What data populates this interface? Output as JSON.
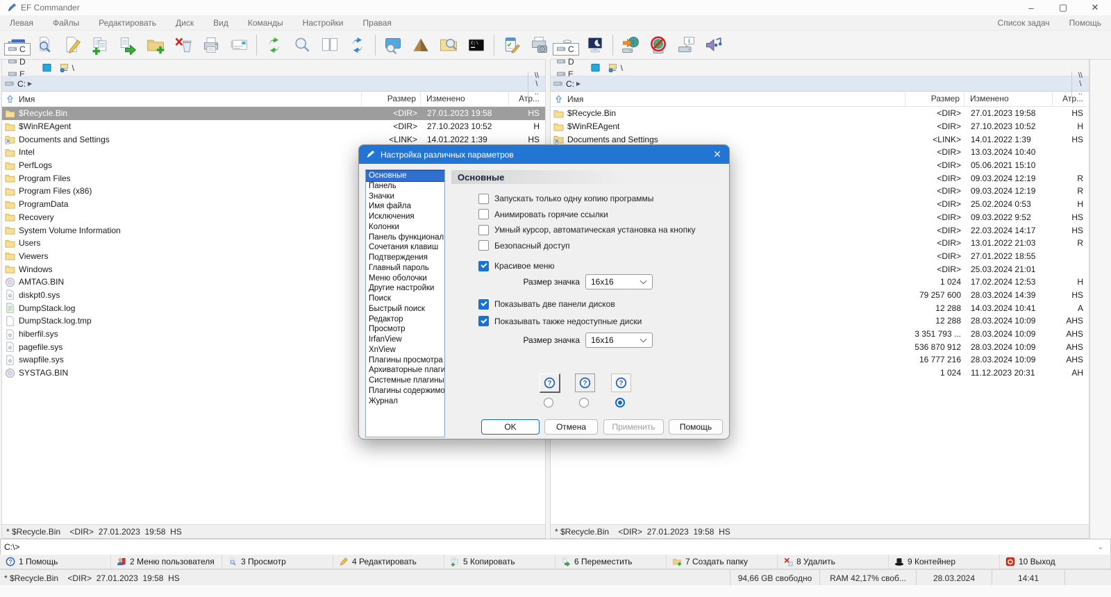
{
  "window": {
    "title": "EF Commander",
    "minimize": "–",
    "maximize": "▢",
    "close": "✕"
  },
  "menu": {
    "items": [
      {
        "label": "Левая"
      },
      {
        "label": "Файлы"
      },
      {
        "label": "Редактировать"
      },
      {
        "label": "Диск"
      },
      {
        "label": "Вид"
      },
      {
        "label": "Команды"
      },
      {
        "label": "Настройки"
      },
      {
        "label": "Правая"
      }
    ],
    "right_items": [
      {
        "label": "Список задач"
      },
      {
        "label": "Помощь"
      }
    ]
  },
  "toolbar": [
    {
      "k": "btn",
      "name": "run-command-button",
      "icon": "#i-run"
    },
    {
      "k": "btn",
      "name": "view-file-button",
      "icon": "#i-viewdoc"
    },
    {
      "k": "btn",
      "name": "edit-file-button",
      "icon": "#i-edit"
    },
    {
      "k": "btn",
      "name": "copy-button",
      "icon": "#i-copy"
    },
    {
      "k": "btn",
      "name": "move-button",
      "icon": "#i-move"
    },
    {
      "k": "btn",
      "name": "new-folder-button",
      "icon": "#i-newfolder"
    },
    {
      "k": "btn",
      "name": "delete-button",
      "icon": "#i-del"
    },
    {
      "k": "btn",
      "name": "print-button",
      "icon": "#i-print"
    },
    {
      "k": "btn",
      "name": "address-card-button",
      "icon": "#i-card"
    },
    {
      "k": "sep",
      "name": "toolbar-separator"
    },
    {
      "k": "btn",
      "name": "refresh-button",
      "icon": "#i-refresh"
    },
    {
      "k": "btn",
      "name": "search-button",
      "icon": "#i-zoom"
    },
    {
      "k": "btn",
      "name": "compare-files-button",
      "icon": "#i-split"
    },
    {
      "k": "btn",
      "name": "sync-dirs-button",
      "icon": "#i-sync"
    },
    {
      "k": "sep",
      "name": "toolbar-separator"
    },
    {
      "k": "btn",
      "name": "fullscreen-view-button",
      "icon": "#i-screenzoom"
    },
    {
      "k": "btn",
      "name": "dir-size-button",
      "icon": "#i-pyramid"
    },
    {
      "k": "btn",
      "name": "folder-search-button",
      "icon": "#i-foldersearch"
    },
    {
      "k": "btn",
      "name": "terminal-button",
      "icon": "#i-terminal"
    },
    {
      "k": "sep",
      "name": "toolbar-separator"
    },
    {
      "k": "btn",
      "name": "options-button",
      "icon": "#i-settings"
    },
    {
      "k": "btn",
      "name": "print-setup-button",
      "icon": "#i-printphoto"
    },
    {
      "k": "btn",
      "name": "recycle-bin-button",
      "icon": "#i-recycle"
    },
    {
      "k": "btn",
      "name": "screensaver-button",
      "icon": "#i-screensaver"
    },
    {
      "k": "sep",
      "name": "toolbar-separator"
    },
    {
      "k": "btn",
      "name": "map-network-drive-button",
      "icon": "#i-netconnect"
    },
    {
      "k": "btn",
      "name": "disconnect-network-drive-button",
      "icon": "#i-netdisconnect"
    },
    {
      "k": "btn",
      "name": "disk-info-button",
      "icon": "#i-diskinfo"
    },
    {
      "k": "btn",
      "name": "sounds-button",
      "icon": "#i-sound"
    }
  ],
  "drivebar": {
    "drives": [
      {
        "label": "C",
        "sel": "true"
      },
      {
        "label": "D"
      },
      {
        "label": "E"
      },
      {
        "label": "F"
      }
    ],
    "root_label": "\\",
    "path": "C:",
    "nav": [
      {
        "label": "\\\\"
      },
      {
        "label": "\\"
      },
      {
        "label": ".."
      }
    ]
  },
  "columns": {
    "name": "Имя",
    "size": "Размер",
    "modified": "Изменено",
    "attr": "Атр..."
  },
  "files": [
    {
      "name": "$Recycle.Bin",
      "icon": "#f-folder",
      "size": "<DIR>",
      "mod": "27.01.2023  19:58",
      "attr": "HS",
      "sel_left": "true"
    },
    {
      "name": "$WinREAgent",
      "icon": "#f-folder",
      "size": "<DIR>",
      "mod": "27.10.2023  10:52",
      "attr": "H"
    },
    {
      "name": "Documents and Settings",
      "icon": "#f-folderlink",
      "size": "<LINK>",
      "mod": "14.01.2022  1:39",
      "attr": "HS"
    },
    {
      "name": "Intel",
      "icon": "#f-folder",
      "size": "<DIR>",
      "mod": "13.03.2024  10:40",
      "attr": ""
    },
    {
      "name": "PerfLogs",
      "icon": "#f-folder",
      "size": "<DIR>",
      "mod": "05.06.2021  15:10",
      "attr": ""
    },
    {
      "name": "Program Files",
      "icon": "#f-folder",
      "size": "<DIR>",
      "mod": "09.03.2024  12:19",
      "attr": "R"
    },
    {
      "name": "Program Files (x86)",
      "icon": "#f-folder",
      "size": "<DIR>",
      "mod": "09.03.2024  12:19",
      "attr": "R"
    },
    {
      "name": "ProgramData",
      "icon": "#f-folder",
      "size": "<DIR>",
      "mod": "25.02.2024  0:53",
      "attr": "H"
    },
    {
      "name": "Recovery",
      "icon": "#f-folder",
      "size": "<DIR>",
      "mod": "09.03.2022  9:52",
      "attr": "HS"
    },
    {
      "name": "System Volume Information",
      "icon": "#f-folder",
      "size": "<DIR>",
      "mod": "22.03.2024  14:17",
      "attr": "HS"
    },
    {
      "name": "Users",
      "icon": "#f-folder",
      "size": "<DIR>",
      "mod": "13.01.2022  21:03",
      "attr": "R"
    },
    {
      "name": "Viewers",
      "icon": "#f-folder",
      "size": "<DIR>",
      "mod": "27.01.2022  18:55",
      "attr": ""
    },
    {
      "name": "Windows",
      "icon": "#f-folder",
      "size": "<DIR>",
      "mod": "25.03.2024  21:01",
      "attr": ""
    },
    {
      "name": "AMTAG.BIN",
      "icon": "#f-cd",
      "size": "1 024",
      "mod": "17.02.2024  12:53",
      "attr": "H"
    },
    {
      "name": "diskpt0.sys",
      "icon": "#f-sys",
      "size": "79 257 600",
      "mod": "28.03.2024  14:39",
      "attr": "HS"
    },
    {
      "name": "DumpStack.log",
      "icon": "#f-log",
      "size": "12 288",
      "mod": "14.03.2024  10:41",
      "attr": "A"
    },
    {
      "name": "DumpStack.log.tmp",
      "icon": "#f-tmp",
      "size": "12 288",
      "mod": "28.03.2024  10:09",
      "attr": "AHS"
    },
    {
      "name": "hiberfil.sys",
      "icon": "#f-sys",
      "size": "3 351 793 ...",
      "mod": "28.03.2024  10:09",
      "attr": "AHS"
    },
    {
      "name": "pagefile.sys",
      "icon": "#f-sys",
      "size": "536 870 912",
      "mod": "28.03.2024  10:09",
      "attr": "AHS"
    },
    {
      "name": "swapfile.sys",
      "icon": "#f-sys",
      "size": "16 777 216",
      "mod": "28.03.2024  10:09",
      "attr": "AHS"
    },
    {
      "name": "SYSTAG.BIN",
      "icon": "#f-cd",
      "size": "1 024",
      "mod": "11.12.2023  20:31",
      "attr": "AH"
    }
  ],
  "panel_status": "* $Recycle.Bin    <DIR>  27.01.2023  19:58  HS",
  "cmdline": {
    "value": "C:\\>",
    "caret": "⌄"
  },
  "function_bar": [
    {
      "label": "1 Помощь",
      "icon": "#f-help",
      "name": "f1-help-button"
    },
    {
      "label": "2 Меню пользователя",
      "icon": "#f-user",
      "name": "f2-user-menu-button"
    },
    {
      "label": "3 Просмотр",
      "icon": "#i-viewdoc",
      "name": "f3-view-button"
    },
    {
      "label": "4 Редактировать",
      "icon": "#f-editpencil",
      "name": "f4-edit-button"
    },
    {
      "label": "5 Копировать",
      "icon": "#i-copy",
      "name": "f5-copy-button"
    },
    {
      "label": "6 Переместить",
      "icon": "#i-move",
      "name": "f6-move-button"
    },
    {
      "label": "7 Создать папку",
      "icon": "#i-newfolder",
      "name": "f7-new-folder-button"
    },
    {
      "label": "8 Удалить",
      "icon": "#f-delx",
      "name": "f8-delete-button"
    },
    {
      "label": "9 Контейнер",
      "icon": "#f-hat",
      "name": "f9-container-button"
    },
    {
      "label": "10 Выход",
      "icon": "#f-exit",
      "name": "f10-exit-button"
    }
  ],
  "statusbar": {
    "left": "* $Recycle.Bin    <DIR>  27.01.2023  19:58  HS",
    "free_space": "94,66 GB свободно",
    "ram": "RAM 42,17% своб...",
    "date": "28.03.2024",
    "time": "14:41"
  },
  "dialog": {
    "title": "Настройка различных параметров",
    "close": "✕",
    "categories": [
      {
        "label": "Основные",
        "sel": "true"
      },
      {
        "label": "Панель"
      },
      {
        "label": "Значки"
      },
      {
        "label": "Имя файла"
      },
      {
        "label": "Исключения"
      },
      {
        "label": "Колонки"
      },
      {
        "label": "Панель функциональнь"
      },
      {
        "label": "Сочетания клавиш"
      },
      {
        "label": "Подтверждения"
      },
      {
        "label": "Главный пароль"
      },
      {
        "label": "Меню оболочки"
      },
      {
        "label": "Другие настройки"
      },
      {
        "label": "Поиск"
      },
      {
        "label": "Быстрый поиск"
      },
      {
        "label": "Редактор"
      },
      {
        "label": "Просмотр"
      },
      {
        "label": "IrfanView"
      },
      {
        "label": "XnView"
      },
      {
        "label": "Плагины просмотра"
      },
      {
        "label": "Архиваторные плагин"
      },
      {
        "label": "Системные плагины"
      },
      {
        "label": "Плагины содержимог"
      },
      {
        "label": "Журнал"
      }
    ],
    "heading": "Основные",
    "group1": [
      {
        "label": "Запускать только одну копию программы",
        "checked": false
      },
      {
        "label": "Анимировать горячие ссылки",
        "checked": false
      },
      {
        "label": "Умный курсор, автоматическая установка на кнопку",
        "checked": false
      },
      {
        "label": "Безопасный доступ",
        "checked": false
      }
    ],
    "pretty_menu": {
      "label": "Красивое меню",
      "checked": true
    },
    "icon_size_label_1": "Размер значка",
    "icon_size_value_1": "16x16",
    "group2": [
      {
        "label": "Показывать две панели дисков",
        "checked": true
      },
      {
        "label": "Показывать также недоступные диски",
        "checked": true
      }
    ],
    "icon_size_label_2": "Размер значка",
    "icon_size_value_2": "16x16",
    "style_options": [
      {
        "sel": "false"
      },
      {
        "sel": "false"
      },
      {
        "sel": "true"
      }
    ],
    "buttons": {
      "ok": "OK",
      "cancel": "Отмена",
      "apply": "Применить",
      "help": "Помощь"
    }
  }
}
